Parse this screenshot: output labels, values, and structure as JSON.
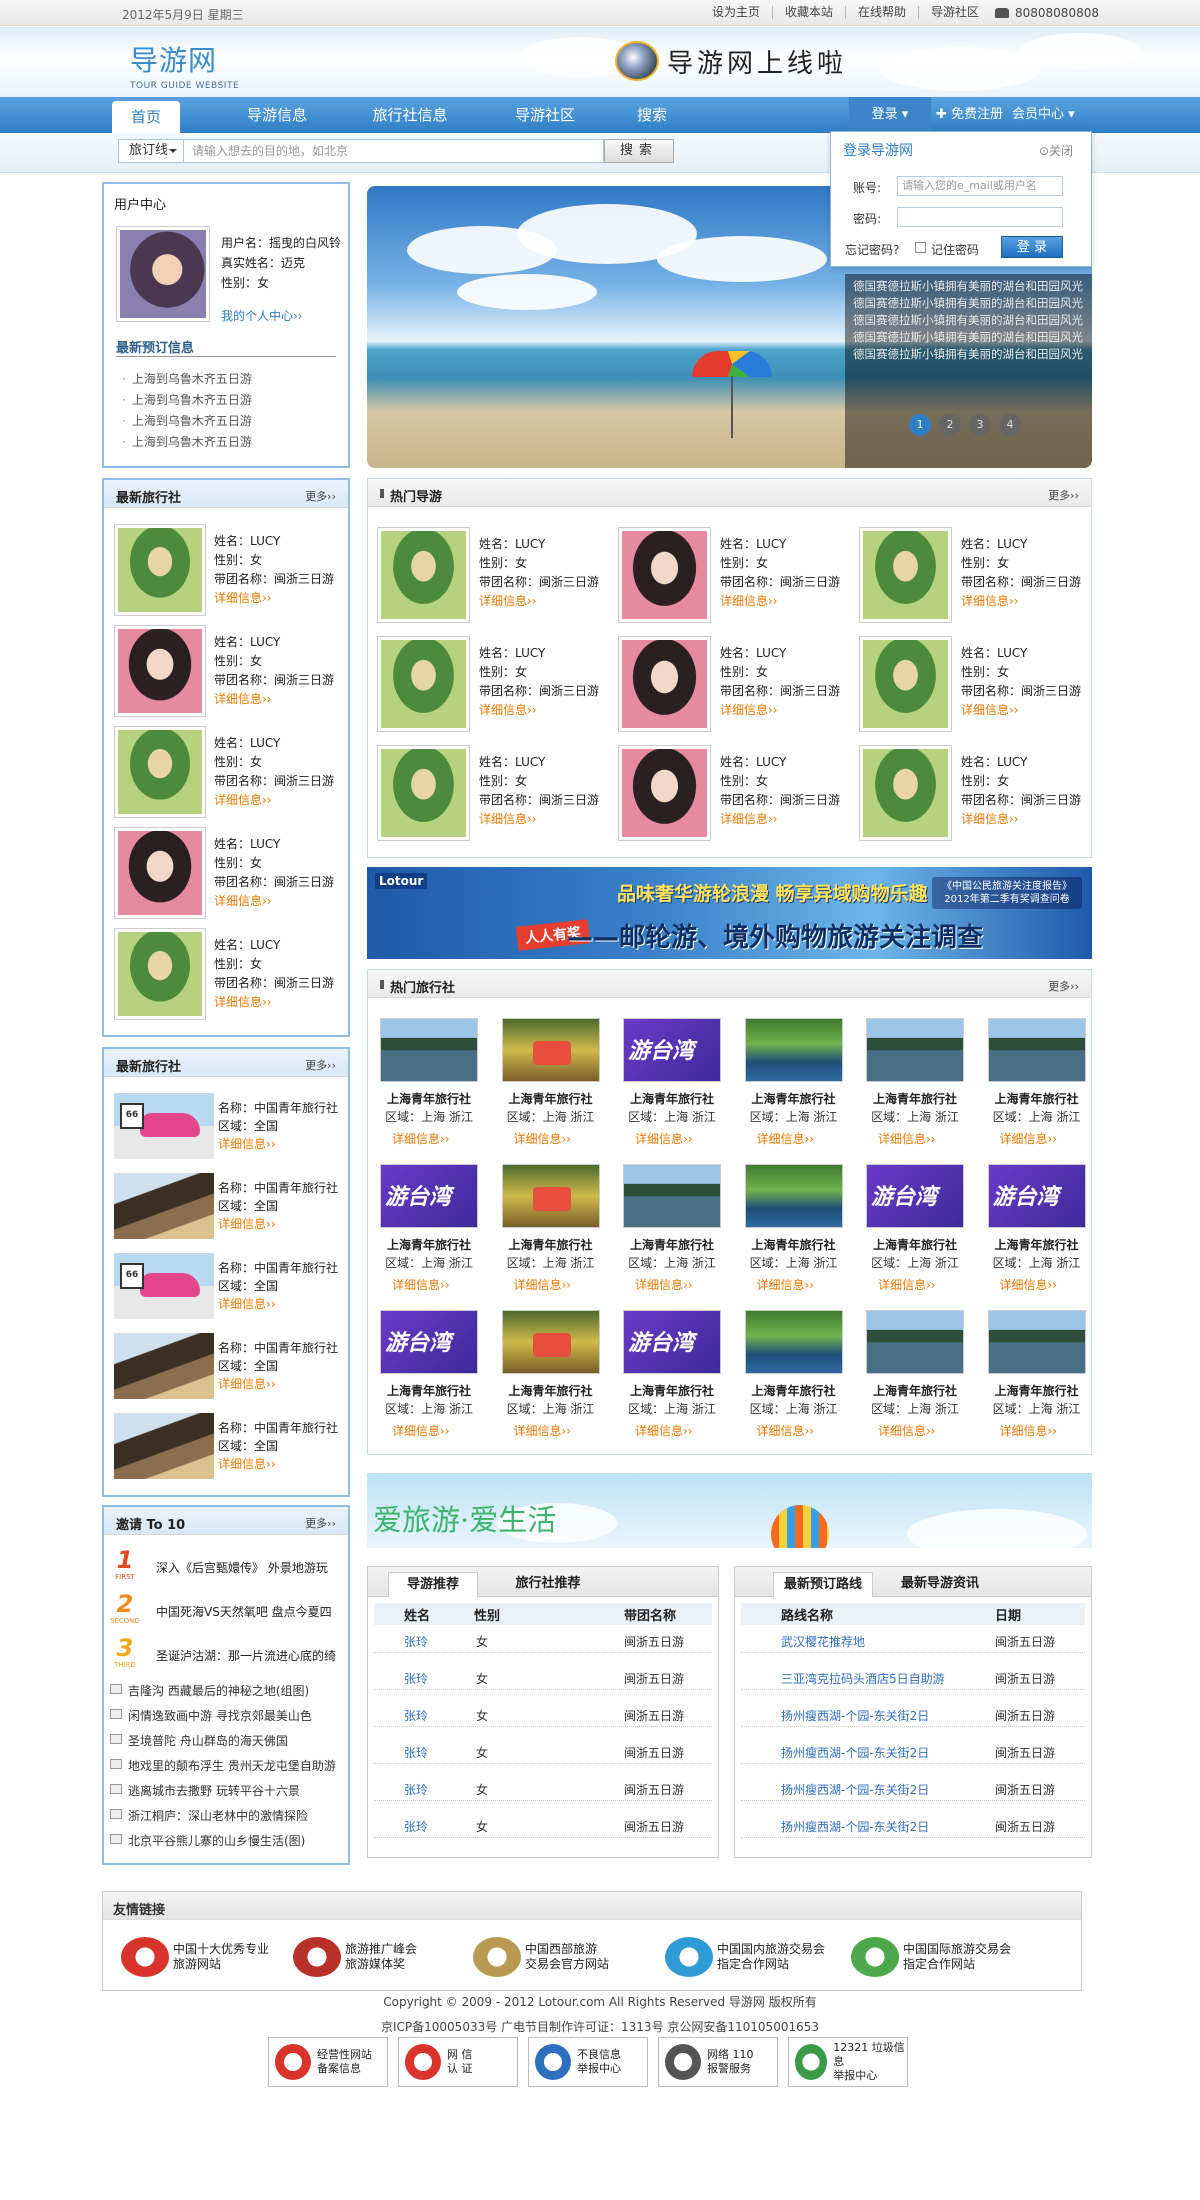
{
  "topbar": {
    "date": "2012年5月9日 星期三",
    "links": [
      "设为主页",
      "收藏本站",
      "在线帮助",
      "导游社区"
    ],
    "phone": "80808080808"
  },
  "logo": {
    "cn": "导游网",
    "en": "TOUR GUIDE WEBSITE"
  },
  "slogan": "导游网上线啦",
  "nav": {
    "items": [
      "首页",
      "导游信息",
      "旅行社信息",
      "导游社区",
      "搜索"
    ],
    "login": "登录 ▾",
    "register": "免费注册",
    "user_center": "会员中心 ▾"
  },
  "search": {
    "select": "旅订线",
    "placeholder": "请输入想去的目的地，如北京",
    "button": "搜索"
  },
  "login_popup": {
    "title": "登录导游网",
    "close": "⊙关闭",
    "account_label": "账号:",
    "account_placeholder": "请输入您的e_mail或用户名",
    "password_label": "密码:",
    "forgot": "忘记密码?",
    "remember": "记住密码",
    "submit": "登 录"
  },
  "user_center": {
    "title": "用户中心",
    "username": "用户名：摇曳的白风铃",
    "realname": "真实姓名：迈克",
    "gender": "性别：女",
    "link": "我的个人中心››",
    "recent_title": "最新预订信息",
    "recent": [
      "上海到乌鲁木齐五日游",
      "上海到乌鲁木齐五日游",
      "上海到乌鲁木齐五日游",
      "上海到乌鲁木齐五日游"
    ]
  },
  "banner": {
    "text": "德国赛德拉斯小镇拥有美丽的湖台和田园风光德国赛德拉斯小镇拥有美丽的湖台和田园风光德国赛德拉斯小镇拥有美丽的湖台和田园风光德国赛德拉斯小镇拥有美丽的湖台和田园风光德国赛德拉斯小镇拥有美丽的湖台和田园风光",
    "pages": [
      "1",
      "2",
      "3",
      "4"
    ]
  },
  "hot_guides": {
    "title": "热门导游",
    "more": "更多››",
    "cards": [
      {
        "name": "姓名：LUCY",
        "gender": "性别：女",
        "group": "带团名称：闽浙三日游",
        "detail": "详细信息››",
        "photo": "green"
      },
      {
        "name": "姓名：LUCY",
        "gender": "性别：女",
        "group": "带团名称：闽浙三日游",
        "detail": "详细信息››",
        "photo": "pink"
      },
      {
        "name": "姓名：LUCY",
        "gender": "性别：女",
        "group": "带团名称：闽浙三日游",
        "detail": "详细信息››",
        "photo": "green"
      },
      {
        "name": "姓名：LUCY",
        "gender": "性别：女",
        "group": "带团名称：闽浙三日游",
        "detail": "详细信息››",
        "photo": "green"
      },
      {
        "name": "姓名：LUCY",
        "gender": "性别：女",
        "group": "带团名称：闽浙三日游",
        "detail": "详细信息››",
        "photo": "pink"
      },
      {
        "name": "姓名：LUCY",
        "gender": "性别：女",
        "group": "带团名称：闽浙三日游",
        "detail": "详细信息››",
        "photo": "green"
      },
      {
        "name": "姓名：LUCY",
        "gender": "性别：女",
        "group": "带团名称：闽浙三日游",
        "detail": "详细信息››",
        "photo": "green"
      },
      {
        "name": "姓名：LUCY",
        "gender": "性别：女",
        "group": "带团名称：闽浙三日游",
        "detail": "详细信息››",
        "photo": "pink"
      },
      {
        "name": "姓名：LUCY",
        "gender": "性别：女",
        "group": "带团名称：闽浙三日游",
        "detail": "详细信息››",
        "photo": "green"
      }
    ]
  },
  "latest_guides": {
    "title": "最新旅行社",
    "more": "更多››",
    "cards": [
      {
        "name": "姓名：LUCY",
        "gender": "性别：女",
        "group": "带团名称：闽浙三日游",
        "detail": "详细信息››",
        "photo": "green"
      },
      {
        "name": "姓名：LUCY",
        "gender": "性别：女",
        "group": "带团名称：闽浙三日游",
        "detail": "详细信息››",
        "photo": "pink"
      },
      {
        "name": "姓名：LUCY",
        "gender": "性别：女",
        "group": "带团名称：闽浙三日游",
        "detail": "详细信息››",
        "photo": "green"
      },
      {
        "name": "姓名：LUCY",
        "gender": "性别：女",
        "group": "带团名称：闽浙三日游",
        "detail": "详细信息››",
        "photo": "pink"
      },
      {
        "name": "姓名：LUCY",
        "gender": "性别：女",
        "group": "带团名称：闽浙三日游",
        "detail": "详细信息››",
        "photo": "green"
      }
    ]
  },
  "latest_agencies": {
    "title": "最新旅行社",
    "more": "更多››",
    "cards": [
      {
        "name": "名称：中国青年旅行社",
        "region": "区域：全国",
        "detail": "详细信息››",
        "photo": "car"
      },
      {
        "name": "名称：中国青年旅行社",
        "region": "区域：全国",
        "detail": "详细信息››",
        "photo": "mtn"
      },
      {
        "name": "名称：中国青年旅行社",
        "region": "区域：全国",
        "detail": "详细信息››",
        "photo": "car"
      },
      {
        "name": "名称：中国青年旅行社",
        "region": "区域：全国",
        "detail": "详细信息››",
        "photo": "mtn"
      },
      {
        "name": "名称：中国青年旅行社",
        "region": "区域：全国",
        "detail": "详细信息››",
        "photo": "mtn"
      }
    ]
  },
  "ad": {
    "logo": "Lotour",
    "line1": "品味奢华游轮浪漫  畅享异域购物乐趣",
    "line2": "——邮轮游、境外购物旅游关注调查",
    "tag": "人人有奖",
    "right": "《中国公民旅游关注度报告》2012年第二季有奖调查问卷"
  },
  "hot_agencies": {
    "title": "热门旅行社",
    "more": "更多››",
    "cards": [
      {
        "name": "上海青年旅行社",
        "region": "区域：上海 浙江",
        "detail": "详细信息››",
        "photo": "water"
      },
      {
        "name": "上海青年旅行社",
        "region": "区域：上海 浙江",
        "detail": "详细信息››",
        "photo": "gold"
      },
      {
        "name": "上海青年旅行社",
        "region": "区域：上海 浙江",
        "detail": "详细信息››",
        "photo": "purple"
      },
      {
        "name": "上海青年旅行社",
        "region": "区域：上海 浙江",
        "detail": "详细信息››",
        "photo": "field"
      },
      {
        "name": "上海青年旅行社",
        "region": "区域：上海 浙江",
        "detail": "详细信息››",
        "photo": "water"
      },
      {
        "name": "上海青年旅行社",
        "region": "区域：上海 浙江",
        "detail": "详细信息››",
        "photo": "water"
      },
      {
        "name": "上海青年旅行社",
        "region": "区域：上海 浙江",
        "detail": "详细信息››",
        "photo": "purple"
      },
      {
        "name": "上海青年旅行社",
        "region": "区域：上海 浙江",
        "detail": "详细信息››",
        "photo": "gold"
      },
      {
        "name": "上海青年旅行社",
        "region": "区域：上海 浙江",
        "detail": "详细信息››",
        "photo": "water"
      },
      {
        "name": "上海青年旅行社",
        "region": "区域：上海 浙江",
        "detail": "详细信息››",
        "photo": "field"
      },
      {
        "name": "上海青年旅行社",
        "region": "区域：上海 浙江",
        "detail": "详细信息››",
        "photo": "purple"
      },
      {
        "name": "上海青年旅行社",
        "region": "区域：上海 浙江",
        "detail": "详细信息››",
        "photo": "purple"
      },
      {
        "name": "上海青年旅行社",
        "region": "区域：上海 浙江",
        "detail": "详细信息››",
        "photo": "purple"
      },
      {
        "name": "上海青年旅行社",
        "region": "区域：上海 浙江",
        "detail": "详细信息››",
        "photo": "gold"
      },
      {
        "name": "上海青年旅行社",
        "region": "区域：上海 浙江",
        "detail": "详细信息››",
        "photo": "purple"
      },
      {
        "name": "上海青年旅行社",
        "region": "区域：上海 浙江",
        "detail": "详细信息››",
        "photo": "field"
      },
      {
        "name": "上海青年旅行社",
        "region": "区域：上海 浙江",
        "detail": "详细信息››",
        "photo": "water"
      },
      {
        "name": "上海青年旅行社",
        "region": "区域：上海 浙江",
        "detail": "详细信息››",
        "photo": "water"
      }
    ]
  },
  "love_banner": "爱旅游·爱生活",
  "invite": {
    "title": "邀请 To 10",
    "more": "更多››",
    "top": [
      {
        "rank": "1",
        "label": "FIRST",
        "text": "深入《后宫甄嬛传》 外景地游玩"
      },
      {
        "rank": "2",
        "label": "SECOND",
        "text": "中国死海VS天然氧吧 盘点今夏四"
      },
      {
        "rank": "3",
        "label": "THIRD",
        "text": "圣诞泸沽湖：那一片流进心底的绮"
      }
    ],
    "list": [
      "吉隆沟 西藏最后的神秘之地(组图)",
      "闲情逸致画中游 寻找京郊最美山色",
      "圣境普陀 舟山群岛的海天佛国",
      "地戏里的颠布浮生 贵州天龙屯堡自助游",
      "逃离城市去撒野 玩转平谷十六景",
      "浙江桐庐：深山老林中的激情探险",
      "北京平谷熊儿寨的山乡慢生活(图)"
    ]
  },
  "guide_tabs": {
    "tabs": [
      "导游推荐",
      "旅行社推荐"
    ],
    "headers": [
      "姓名",
      "性别",
      "带团名称"
    ],
    "rows": [
      [
        "张玲",
        "女",
        "闽浙五日游"
      ],
      [
        "张玲",
        "女",
        "闽浙五日游"
      ],
      [
        "张玲",
        "女",
        "闽浙五日游"
      ],
      [
        "张玲",
        "女",
        "闽浙五日游"
      ],
      [
        "张玲",
        "女",
        "闽浙五日游"
      ],
      [
        "张玲",
        "女",
        "闽浙五日游"
      ]
    ]
  },
  "route_tabs": {
    "tabs": [
      "最新预订路线",
      "最新导游资讯"
    ],
    "headers": [
      "路线名称",
      "日期"
    ],
    "rows": [
      [
        "武汉樱花推荐地",
        "闽浙五日游"
      ],
      [
        "三亚湾克拉码头酒店5日自助游",
        "闽浙五日游"
      ],
      [
        "扬州瘦西湖-个园-东关街2日",
        "闽浙五日游"
      ],
      [
        "扬州瘦西湖-个园-东关街2日",
        "闽浙五日游"
      ],
      [
        "扬州瘦西湖-个园-东关街2日",
        "闽浙五日游"
      ],
      [
        "扬州瘦西湖-个园-东关街2日",
        "闽浙五日游"
      ]
    ]
  },
  "partners": {
    "title": "友情链接",
    "items": [
      {
        "text1": "中国十大优秀专业",
        "text2": "旅游网站",
        "color": "#d9342b"
      },
      {
        "text1": "旅游推广峰会",
        "text2": "旅游媒体奖",
        "color": "#b8302a"
      },
      {
        "text1": "中国西部旅游",
        "text2": "交易会官方网站",
        "color": "#b89a52"
      },
      {
        "text1": "中国国内旅游交易会",
        "text2": "指定合作网站",
        "color": "#2f9bd6"
      },
      {
        "text1": "中国国际旅游交易会",
        "text2": "指定合作网站",
        "color": "#4ca84a"
      }
    ]
  },
  "footer": {
    "copyright": "Copyright © 2009 - 2012 Lotour.com  All Rights Reserved  导游网  版权所有",
    "icp": "京ICP备10005033号  广电节目制作许可证：1313号  京公网安备110105001653",
    "badges": [
      {
        "l1": "经营性网站",
        "l2": "备案信息",
        "color": "#d9342b"
      },
      {
        "l1": "网 信",
        "l2": "认 证",
        "color": "#d9342b"
      },
      {
        "l1": "不良信息",
        "l2": "举报中心",
        "color": "#2f6fbf"
      },
      {
        "l1": "网络 110",
        "l2": "报警服务",
        "color": "#555"
      },
      {
        "l1": "12321 垃圾信息",
        "l2": "举报中心",
        "color": "#3a9a48"
      }
    ]
  }
}
